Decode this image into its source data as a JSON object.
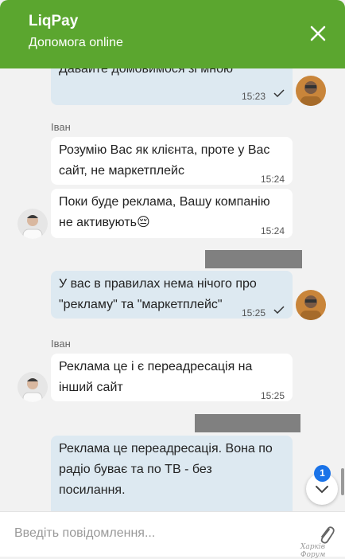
{
  "header": {
    "title": "LiqPay",
    "subtitle": "Допомога online"
  },
  "messages": [
    {
      "from": "user",
      "text": "Давайте домовимося зі мною",
      "time": "15:23",
      "read": true
    },
    {
      "from": "agent",
      "sender": "Іван",
      "text": "Розумію Вас як клієнта, проте у  Вас\nсайт, не маркетплейс",
      "time": "15:24"
    },
    {
      "from": "agent",
      "text": "Поки буде реклама, Вашу компанію\nне активують😔",
      "time": "15:24"
    },
    {
      "from": "user",
      "text": "У вас в правилах нема нічого про\n\"рекламу\" та \"маркетплейс\"",
      "time": "15:25",
      "read": true
    },
    {
      "from": "agent",
      "sender": "Іван",
      "text": "Реклама це і є переадресація на\nінший сайт",
      "time": "15:25"
    },
    {
      "from": "user",
      "text": "Реклама це переадресація. Вона по\nрадіо буває та по ТВ - без\nпосилання.",
      "time": ""
    }
  ],
  "unread_count": "1",
  "composer": {
    "placeholder": "Введіть повідомлення..."
  },
  "watermark": "Харків Форум",
  "icons": {
    "close": "close-icon",
    "read": "checkmark-icon",
    "scroll": "chevron-down-icon",
    "attach": "paperclip-icon"
  },
  "colors": {
    "header": "#5ba62f",
    "own_bubble": "#dde9f1",
    "badge": "#1a73e8"
  }
}
